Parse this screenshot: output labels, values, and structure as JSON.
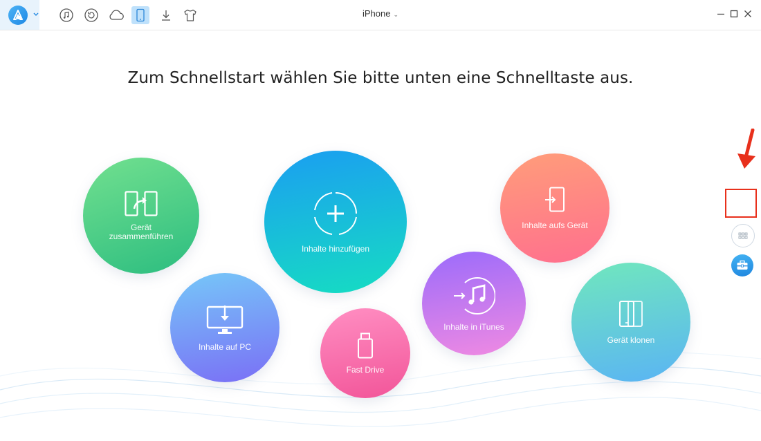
{
  "titlebar": {
    "device_name": "iPhone",
    "toolbar_icons": [
      "music-icon",
      "backup-restore-icon",
      "cloud-icon",
      "phone-icon",
      "download-icon",
      "tshirt-icon"
    ],
    "active_icon": "phone-icon",
    "accent_color": "#2196f3"
  },
  "main": {
    "headline": "Zum Schnellstart wählen Sie bitte unten eine Schnelltaste aus.",
    "tiles": [
      {
        "id": "merge",
        "label_line1": "Gerät",
        "label_line2": "zusammenführen",
        "icon": "merge-device-icon",
        "colors": [
          "#6fdd8f",
          "#2ebf7f"
        ]
      },
      {
        "id": "add",
        "label": "Inhalte hinzufügen",
        "icon": "add-content-icon",
        "colors": [
          "#1a9df0",
          "#17dcc3"
        ]
      },
      {
        "id": "to-device",
        "label": "Inhalte aufs Gerät",
        "icon": "to-device-icon",
        "colors": [
          "#ff9a7a",
          "#ff6f8e"
        ]
      },
      {
        "id": "to-pc",
        "label": "Inhalte auf PC",
        "icon": "to-pc-icon",
        "colors": [
          "#74c6f8",
          "#7a6ff6"
        ]
      },
      {
        "id": "fast-drive",
        "label": "Fast Drive",
        "icon": "usb-drive-icon",
        "colors": [
          "#ff8db5",
          "#f3579a"
        ]
      },
      {
        "id": "to-itunes",
        "label": "Inhalte in iTunes",
        "icon": "to-itunes-icon",
        "colors": [
          "#9a6cfb",
          "#f08ae0"
        ]
      },
      {
        "id": "clone",
        "label": "Gerät klonen",
        "icon": "clone-device-icon",
        "colors": [
          "#6fe6bf",
          "#5db7f3"
        ]
      }
    ]
  },
  "side": {
    "items": [
      "apps-grid-icon",
      "toolbox-icon"
    ]
  }
}
